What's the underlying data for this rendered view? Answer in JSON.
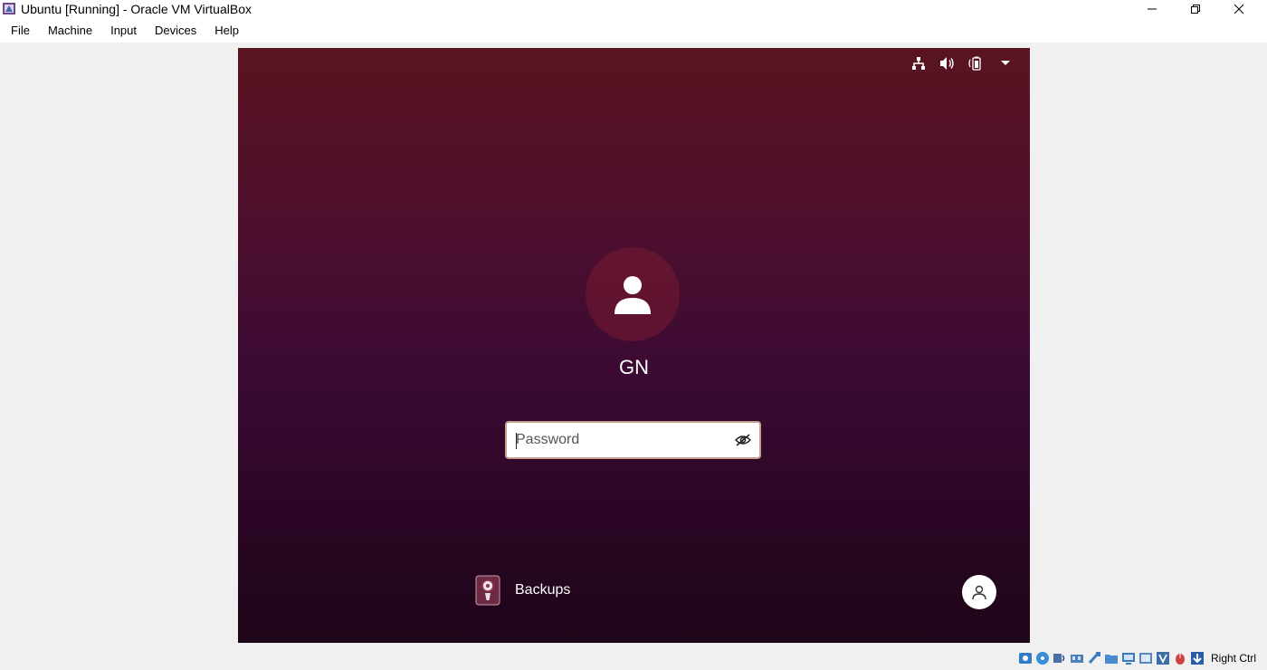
{
  "window": {
    "title": "Ubuntu [Running] - Oracle VM VirtualBox",
    "app_icon": "virtualbox-icon"
  },
  "menu": {
    "items": [
      "File",
      "Machine",
      "Input",
      "Devices",
      "Help"
    ]
  },
  "login": {
    "username": "GN",
    "password_placeholder": "Password",
    "session_label": "Backups",
    "tray_icons": [
      "network-icon",
      "volume-icon",
      "battery-icon",
      "dropdown-arrow-icon"
    ]
  },
  "statusbar": {
    "host_key": "Right Ctrl",
    "icons": [
      "hard-disk-icon",
      "optical-drive-icon",
      "audio-icon",
      "network-adapter-icon",
      "usb-icon",
      "shared-folders-icon",
      "display-icon",
      "video-capture-icon",
      "virtualization-icon",
      "mouse-integration-icon",
      "host-key-arrow-icon"
    ]
  },
  "colors": {
    "vm_top": "#5a1420",
    "vm_bottom": "#1e0518",
    "password_border": "#c9a08a"
  }
}
